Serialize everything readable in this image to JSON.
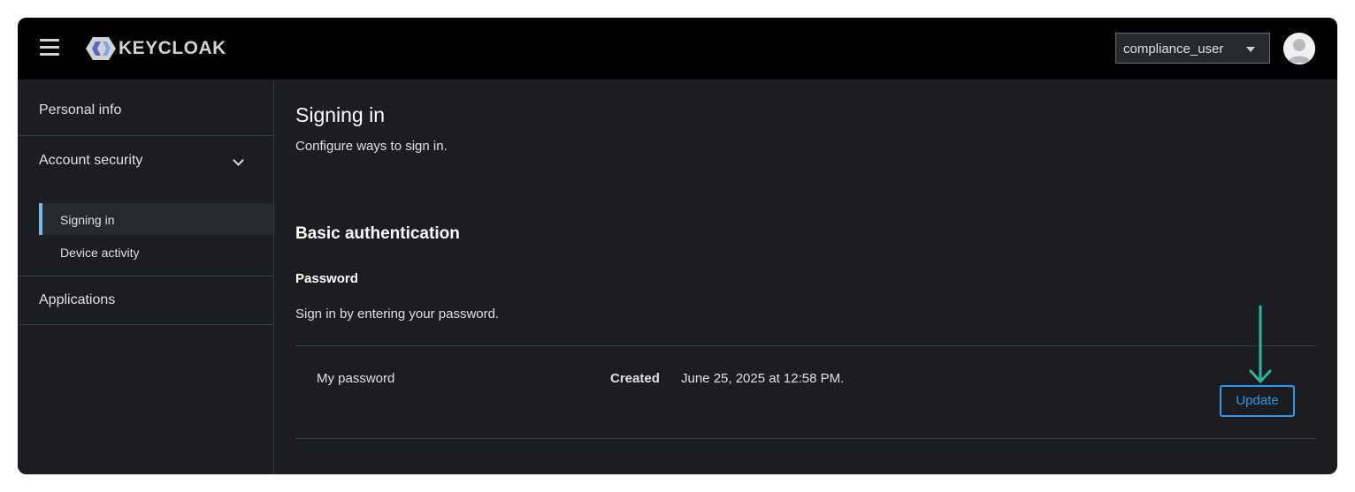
{
  "app": {
    "brand": "KEYCLOAK"
  },
  "header": {
    "user": "compliance_user"
  },
  "sidebar": {
    "personal_info": "Personal info",
    "account_security": "Account security",
    "signing_in": "Signing in",
    "device_activity": "Device activity",
    "applications": "Applications"
  },
  "main": {
    "title": "Signing in",
    "subtitle": "Configure ways to sign in.",
    "section": "Basic authentication",
    "credential": {
      "title": "Password",
      "help": "Sign in by entering your password.",
      "name": "My password",
      "created_label": "Created",
      "created_value": "June 25, 2025 at 12:58 PM.",
      "update_label": "Update"
    }
  },
  "colors": {
    "accent": "#2b9af3",
    "annotation_arrow": "#2ab5a5",
    "nav_active": "#73bcf7"
  }
}
